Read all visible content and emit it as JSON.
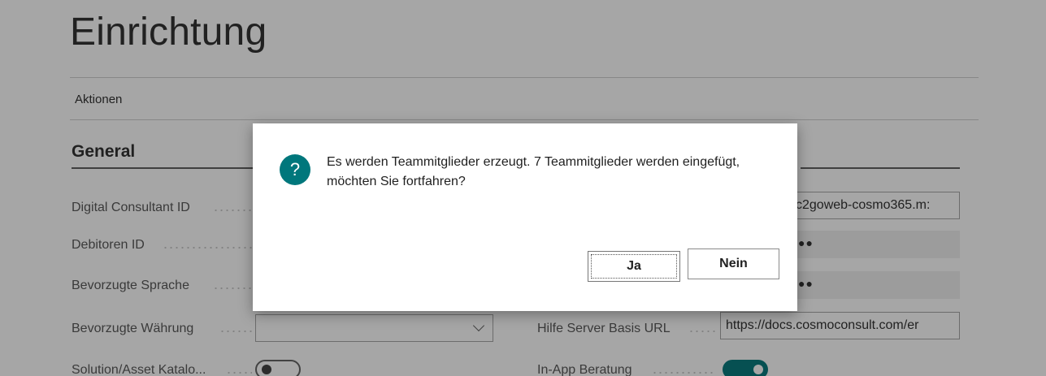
{
  "page": {
    "title": "Einrichtung",
    "actions_label": "Aktionen",
    "section_title": "General"
  },
  "fields": {
    "digital_consultant_id": {
      "label": "Digital Consultant ID"
    },
    "debitoren_id": {
      "label": "Debitoren ID"
    },
    "bevorzugte_sprache": {
      "label": "Bevorzugte Sprache"
    },
    "bevorzugte_waehrung": {
      "label": "Bevorzugte Währung",
      "value": ""
    },
    "solution_katalog": {
      "label": "Solution/Asset Katalo...",
      "enabled": false
    },
    "right_url_field": {
      "value": "c2goweb-cosmo365.m:"
    },
    "right_masked_1": {
      "value": "●●"
    },
    "right_masked_2": {
      "value": "●●"
    },
    "hilfe_server": {
      "label": "Hilfe Server Basis URL",
      "value": "https://docs.cosmoconsult.com/er"
    },
    "in_app_beratung": {
      "label": "In-App Beratung",
      "enabled": true
    }
  },
  "dialog": {
    "icon": "question-icon",
    "icon_glyph": "?",
    "message": "Es werden Teammitglieder erzeugt. 7 Teammitglieder werden eingefügt, möchten Sie fortfahren?",
    "yes_label": "Ja",
    "no_label": "Nein"
  },
  "colors": {
    "accent": "#00777c",
    "toggle_on": "#0a7c7f"
  }
}
